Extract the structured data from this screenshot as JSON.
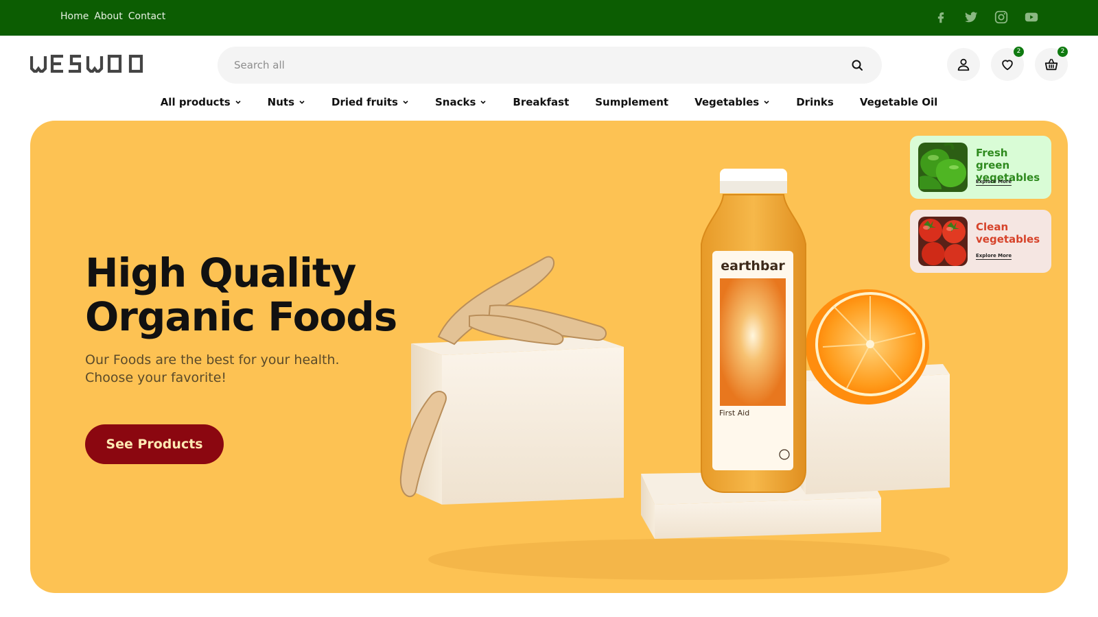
{
  "topbar": {
    "links": [
      "Home",
      "About",
      "Contact"
    ],
    "socials": [
      "facebook-icon",
      "twitter-icon",
      "instagram-icon",
      "youtube-icon"
    ],
    "bg_color": "#0c5d02"
  },
  "header": {
    "logo_text": "WESWOO",
    "search_placeholder": "Search all",
    "wishlist_count": "2",
    "cart_count": "2"
  },
  "nav": {
    "items": [
      {
        "label": "All products",
        "has_dropdown": true
      },
      {
        "label": "Nuts",
        "has_dropdown": true
      },
      {
        "label": "Dried fruits",
        "has_dropdown": true
      },
      {
        "label": "Snacks",
        "has_dropdown": true
      },
      {
        "label": "Breakfast",
        "has_dropdown": false
      },
      {
        "label": "Sumplement",
        "has_dropdown": false
      },
      {
        "label": "Vegetables",
        "has_dropdown": true
      },
      {
        "label": "Drinks",
        "has_dropdown": false
      },
      {
        "label": "Vegetable Oil",
        "has_dropdown": false
      }
    ]
  },
  "hero": {
    "title": "High Quality Organic Foods",
    "subtitle": "Our Foods are the best for your health. Choose your favorite!",
    "cta_label": "See Products",
    "bg_color": "#fdc253",
    "cta_color": "#8b0710",
    "bottle_brand": "earthbar",
    "bottle_label": "First Aid"
  },
  "promos": [
    {
      "title": "Fresh green vegetables",
      "link": "Explore More",
      "bg": "#d9fcd6",
      "title_color": "#2e8a1e"
    },
    {
      "title": "Clean vegetables",
      "link": "Explore More",
      "bg": "#f5e6e2",
      "title_color": "#d6432a"
    }
  ]
}
